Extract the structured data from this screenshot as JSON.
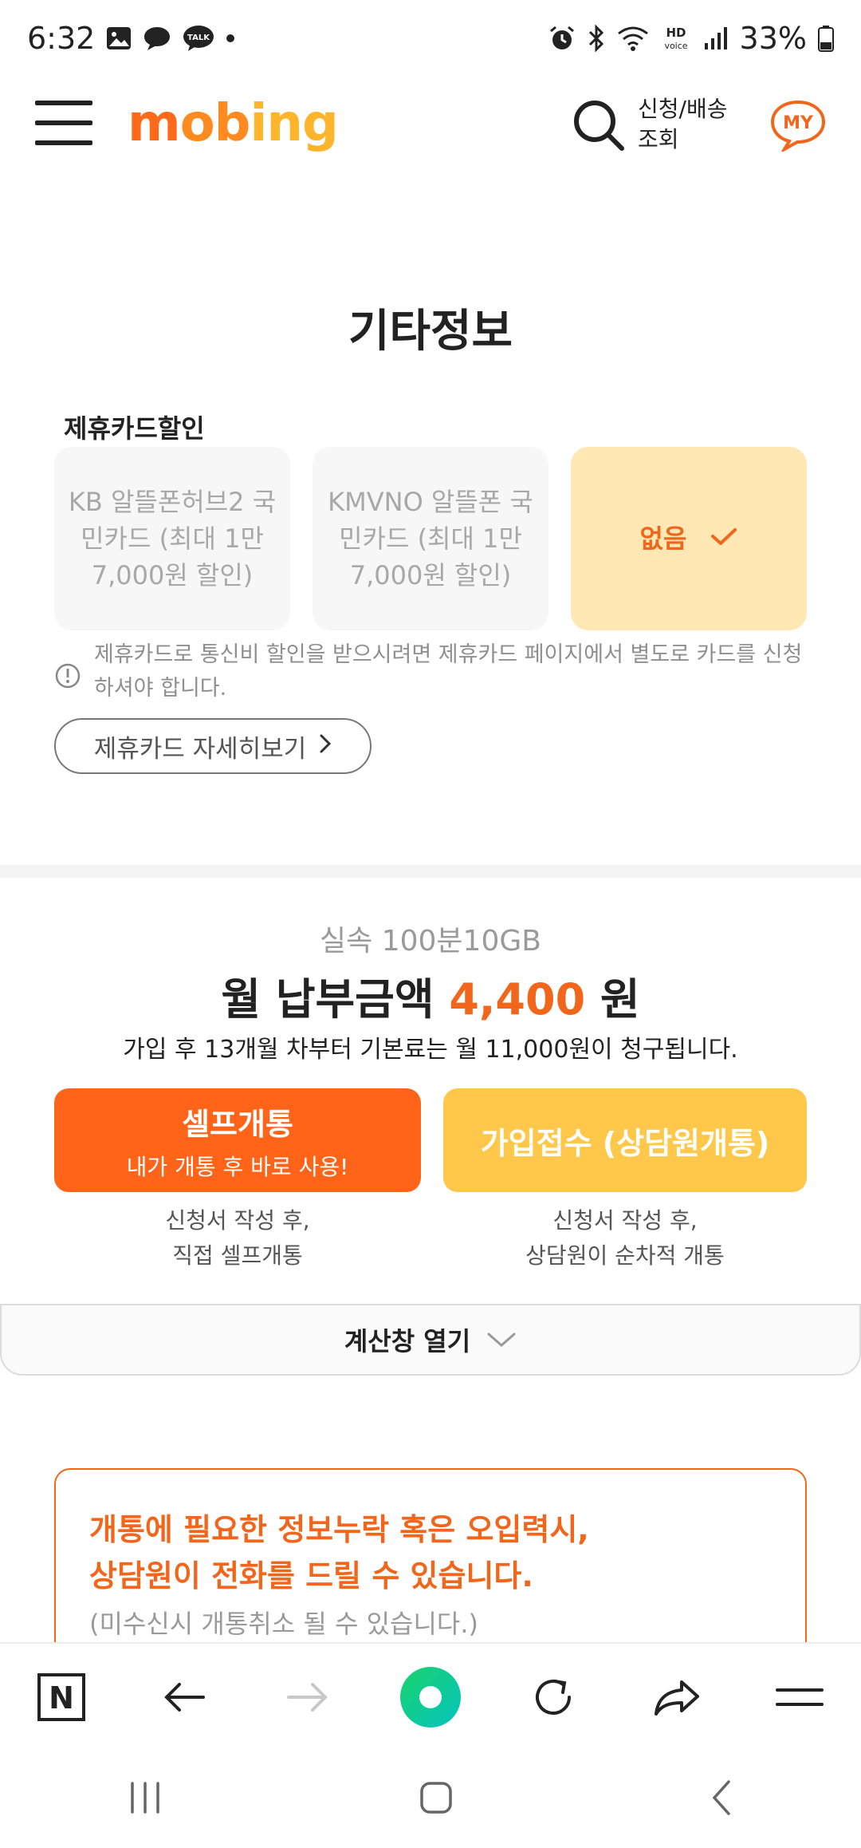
{
  "status_bar": {
    "time": "6:32",
    "talk_badge": "TALK",
    "hd_label": "HD",
    "voice_label": "voice",
    "battery_percent": "33%"
  },
  "header": {
    "logo_parts": [
      "m",
      "ob",
      "ing"
    ],
    "track_label_line1": "신청/배송",
    "track_label_line2": "조회",
    "my_label": "MY"
  },
  "section": {
    "title": "기타정보",
    "card_label": "제휴카드할인"
  },
  "cards": [
    {
      "text": "KB 알뜰폰허브2 국민카드 (최대 1만7,000원 할인)",
      "selected": false
    },
    {
      "text": "KMVNO 알뜰폰 국민카드 (최대 1만7,000원 할인)",
      "selected": false
    },
    {
      "text": "없음",
      "selected": true
    }
  ],
  "notice_text": "제휴카드로 통신비 할인을 받으시려면 제휴카드 페이지에서 별도로 카드를 신청하셔야 합니다.",
  "detail_button": "제휴카드 자세히보기",
  "plan": {
    "name": "실속 100분10GB",
    "price_prefix": "월 납부금액 ",
    "price_amount": "4,400",
    "price_unit": " 원",
    "billing_note": "가입 후 13개월 차부터 기본료는 월 11,000원이 청구됩니다."
  },
  "buttons": {
    "self_main": "셀프개통",
    "self_sub": "내가 개통 후 바로 사용!",
    "join": "가입접수 (상담원개통)",
    "self_caption_1": "신청서 작성 후,",
    "self_caption_2": "직접 셀프개통",
    "join_caption_1": "신청서 작성 후,",
    "join_caption_2": "상담원이 순차적 개통"
  },
  "calc_bar": {
    "label": "계산창 열기"
  },
  "warning": {
    "line1": "개통에 필요한 정보누락 혹은 오입력시,",
    "line2": "상담원이 전화를 드릴 수 있습니다.",
    "line3": "(미수신시 개통취소 될 수 있습니다.)"
  },
  "browser_toolbar": {
    "home_label": "N"
  },
  "colors": {
    "accent": "#f2661b",
    "self_button": "#ff6419",
    "join_button": "#ffc84a",
    "selected_card": "#ffe8b3"
  }
}
